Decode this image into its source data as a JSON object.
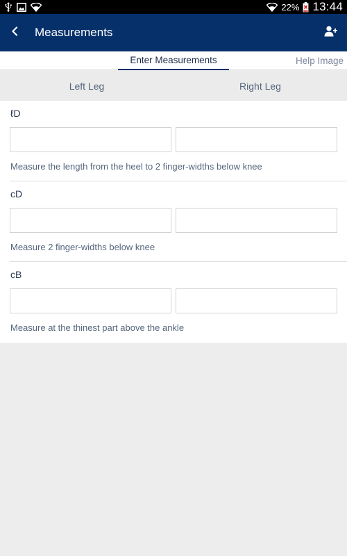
{
  "status_bar": {
    "battery_percent": "22%",
    "time": "13:44",
    "icons": [
      "usb-icon",
      "image-icon",
      "wifi-icon",
      "wifi-icon",
      "battery-icon"
    ]
  },
  "app_bar": {
    "title": "Measurements",
    "background": "#06306a",
    "back_icon": "chevron-left-icon",
    "action_icon": "add-user-icon"
  },
  "tabs": [
    {
      "label": "Enter Measurements",
      "active": true
    },
    {
      "label": "Help Image",
      "active": false
    }
  ],
  "legs": {
    "left": "Left Leg",
    "right": "Right Leg"
  },
  "sections": [
    {
      "label": "ℓD",
      "left_value": "",
      "right_value": "",
      "hint": "Measure the length from the heel to 2 finger-widths below knee"
    },
    {
      "label": "cD",
      "left_value": "",
      "right_value": "",
      "hint": "Measure 2 finger-widths below knee"
    },
    {
      "label": "cB",
      "left_value": "",
      "right_value": "",
      "hint": "Measure at the thinest part above the ankle"
    }
  ]
}
